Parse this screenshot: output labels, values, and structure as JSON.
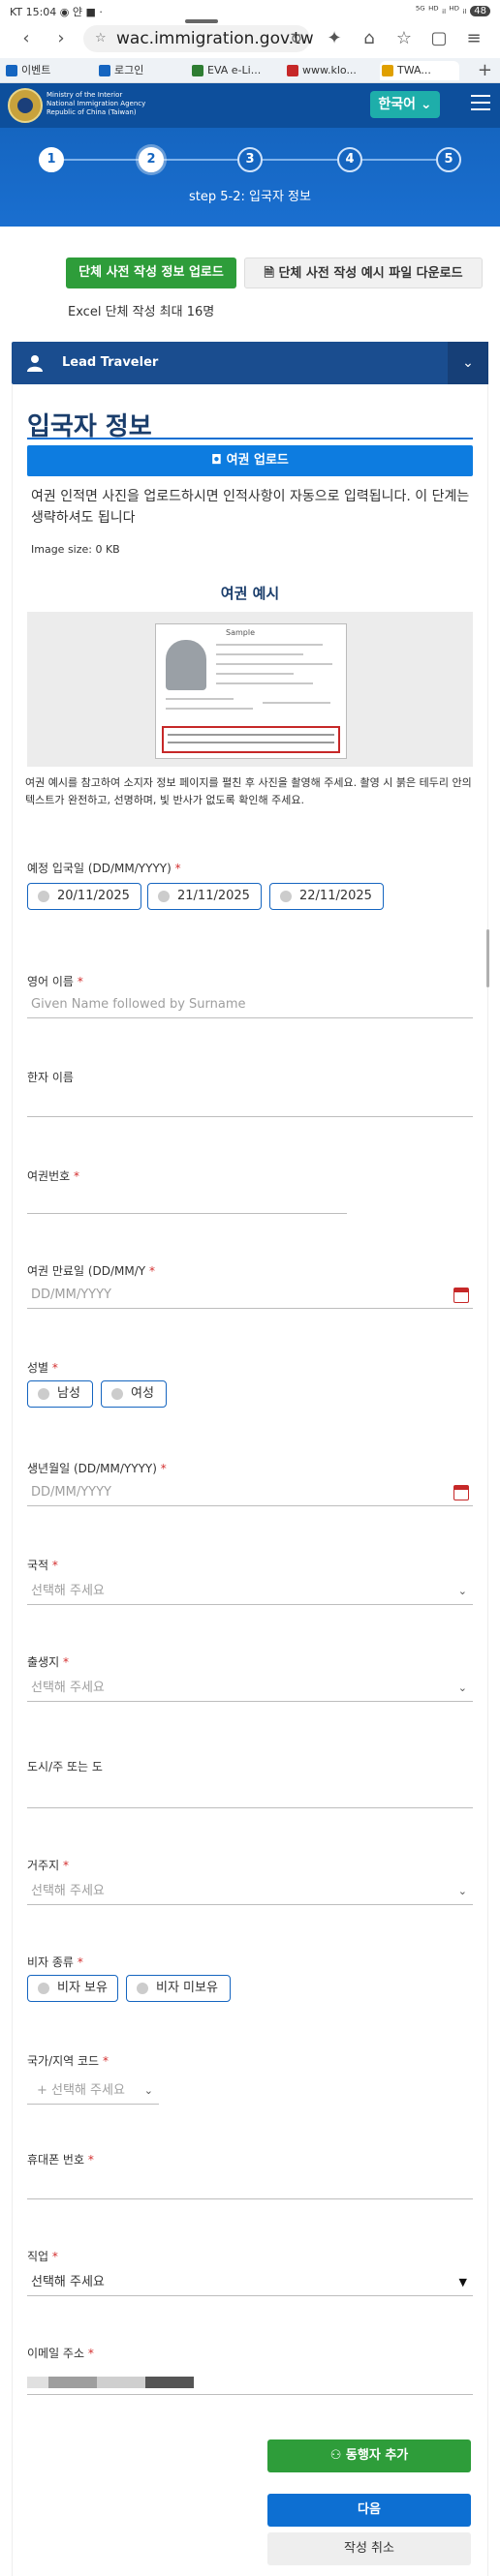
{
  "status_bar": {
    "left": "KT 15:04 ◉ 얀 ■ ·",
    "right": "⁵ᴳ ᴴᴰ ᵢₗ ᴴᴰ ᵢₗ",
    "battery": "48"
  },
  "browser": {
    "url": "wac.immigration.gov.tw",
    "tabs": [
      {
        "label": "이벤트",
        "color": "#1565c0"
      },
      {
        "label": "로그인",
        "color": "#1565c0"
      },
      {
        "label": "EVA e-Li...",
        "color": "#2e7d32"
      },
      {
        "label": "www.klo...",
        "color": "#c62828"
      },
      {
        "label": "TWA...",
        "color": "#e0a000"
      }
    ]
  },
  "header": {
    "agency_lines": [
      "Ministry of the Interior",
      "National Immigration Agency",
      "Republic of China (Taiwan)"
    ],
    "language": "한국어 ⌄",
    "brand_color": "#0d4f9c"
  },
  "stepper": {
    "steps": [
      "1",
      "2",
      "3",
      "4",
      "5"
    ],
    "current": 2,
    "label": "step 5-2: 입국자 정보"
  },
  "upload": {
    "group_upload": "단체 사전 작성 정보 업로드",
    "group_download": "단체 사전 작성 예시 파일 다운로드",
    "excel_note": "Excel 단체 작성 최대 16명"
  },
  "lead": {
    "label": "Lead Traveler"
  },
  "form": {
    "title": "입국자 정보",
    "passport_upload": "여권 업로드",
    "passport_note": "여권 인적면 사진을 업로드하시면 인적사항이 자동으로 입력됩니다. 이 단계는 생략하셔도 됩니다",
    "image_size": "Image size: 0 KB",
    "sample_title": "여권 예시",
    "sample_word": "Sample",
    "sample_note": "여권 예시를 참고하여 소지자 정보 페이지를 펼친 후 사진을 촬영해 주세요. 촬영 시 붉은 테두리 안의 텍스트가 완전하고, 선명하며, 빛 반사가 없도록 확인해 주세요.",
    "arrival_date": {
      "label": "예정 입국일 (DD/MM/YYYY)",
      "options": [
        "20/11/2025",
        "21/11/2025",
        "22/11/2025"
      ]
    },
    "english_name": {
      "label": "영어 이름",
      "placeholder": "Given Name followed by Surname"
    },
    "chinese_name": {
      "label": "한자 이름"
    },
    "passport_no": {
      "label": "여권번호"
    },
    "passport_expiry": {
      "label": "여권 만료일 (DD/MM/Y",
      "placeholder": "DD/MM/YYYY"
    },
    "gender": {
      "label": "성별",
      "options": [
        "남성",
        "여성"
      ]
    },
    "birth_date": {
      "label": "생년월일 (DD/MM/YYYY)",
      "placeholder": "DD/MM/YYYY"
    },
    "nationality": {
      "label": "국적",
      "placeholder": "선택해 주세요"
    },
    "birthplace": {
      "label": "출생지",
      "placeholder": "선택해 주세요"
    },
    "city": {
      "label": "도시/주 또는 도"
    },
    "residence": {
      "label": "거주지",
      "placeholder": "선택해 주세요"
    },
    "visa_type": {
      "label": "비자 종류",
      "options": [
        "비자 보유",
        "비자 미보유"
      ]
    },
    "phone_code": {
      "label": "국가/지역 코드",
      "placeholder": "+ 선택해 주세요"
    },
    "mobile": {
      "label": "휴대폰 번호"
    },
    "occupation": {
      "label": "직업",
      "value": "선택해 주세요"
    },
    "email": {
      "label": "이메일 주소"
    }
  },
  "actions": {
    "add_companion": "동행자 추가",
    "next": "다음",
    "cancel": "작성 취소"
  }
}
